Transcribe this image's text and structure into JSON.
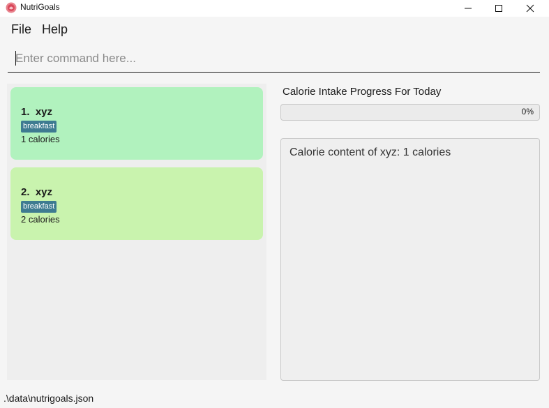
{
  "window": {
    "title": "NutriGoals",
    "app_icon": "nutrigoals-logo-icon",
    "controls": [
      "minimize-icon",
      "maximize-icon",
      "close-icon"
    ]
  },
  "menu": {
    "items": [
      "File",
      "Help"
    ]
  },
  "command": {
    "placeholder": "Enter command here...",
    "value": ""
  },
  "food_list": [
    {
      "index_name": "1.  xyz",
      "tag": "breakfast",
      "calories": "1 calories",
      "color": "#b1f2be"
    },
    {
      "index_name": "2.  xyz",
      "tag": "breakfast",
      "calories": "2 calories",
      "color": "#c9f3ae"
    }
  ],
  "progress": {
    "title": "Calorie Intake Progress For Today",
    "label": "0%",
    "fraction": 0
  },
  "result": {
    "text": "Calorie content of xyz: 1 calories"
  },
  "status": {
    "file_path": ".\\data\\nutrigoals.json"
  },
  "colors": {
    "tag_bg": "#3e7b91"
  }
}
